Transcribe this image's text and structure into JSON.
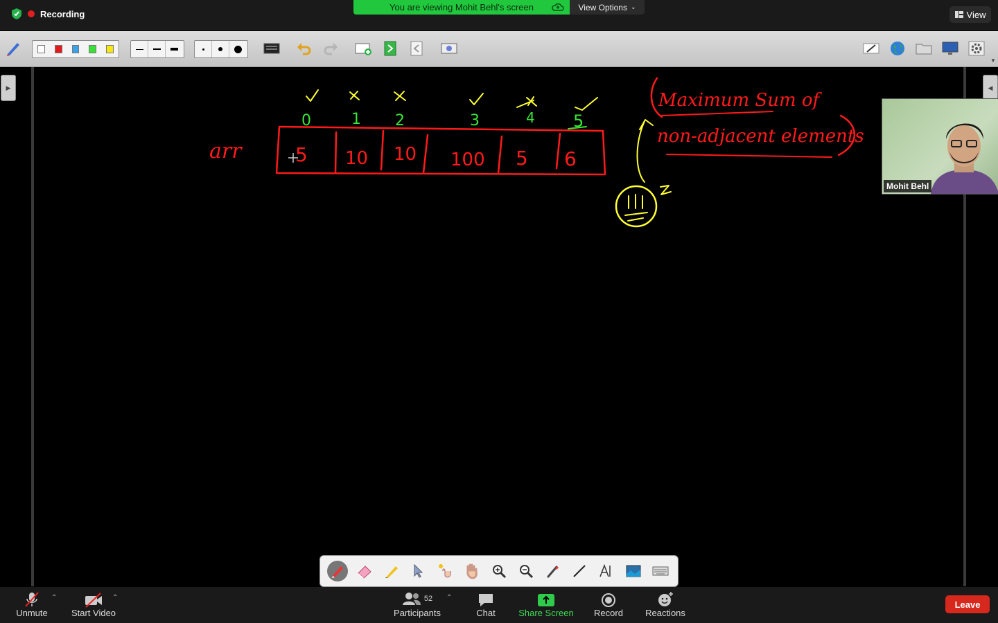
{
  "top_bar": {
    "recording_label": "Recording",
    "viewing_banner": "You are viewing Mohit Behl's screen",
    "view_options_label": "View Options",
    "view_button_label": "View"
  },
  "whiteboard": {
    "array_label": "arr",
    "indices": [
      "0",
      "1",
      "2",
      "3",
      "4",
      "5"
    ],
    "values": [
      "5",
      "10",
      "10",
      "100",
      "5",
      "6"
    ],
    "index_marks": [
      "check",
      "cross",
      "cross",
      "check",
      "cross",
      "check"
    ],
    "title_line1": "Maximum Sum of",
    "title_line2": "non-adjacent elements",
    "colors": {
      "ink_red": "#ff1a1a",
      "ink_green": "#39e639",
      "ink_yellow": "#ffff33"
    }
  },
  "participant": {
    "name": "Mohit Behl"
  },
  "bottom_bar": {
    "unmute_label": "Unmute",
    "start_video_label": "Start Video",
    "participants_label": "Participants",
    "participants_count": "52",
    "chat_label": "Chat",
    "share_screen_label": "Share Screen",
    "record_label": "Record",
    "reactions_label": "Reactions",
    "leave_label": "Leave"
  }
}
